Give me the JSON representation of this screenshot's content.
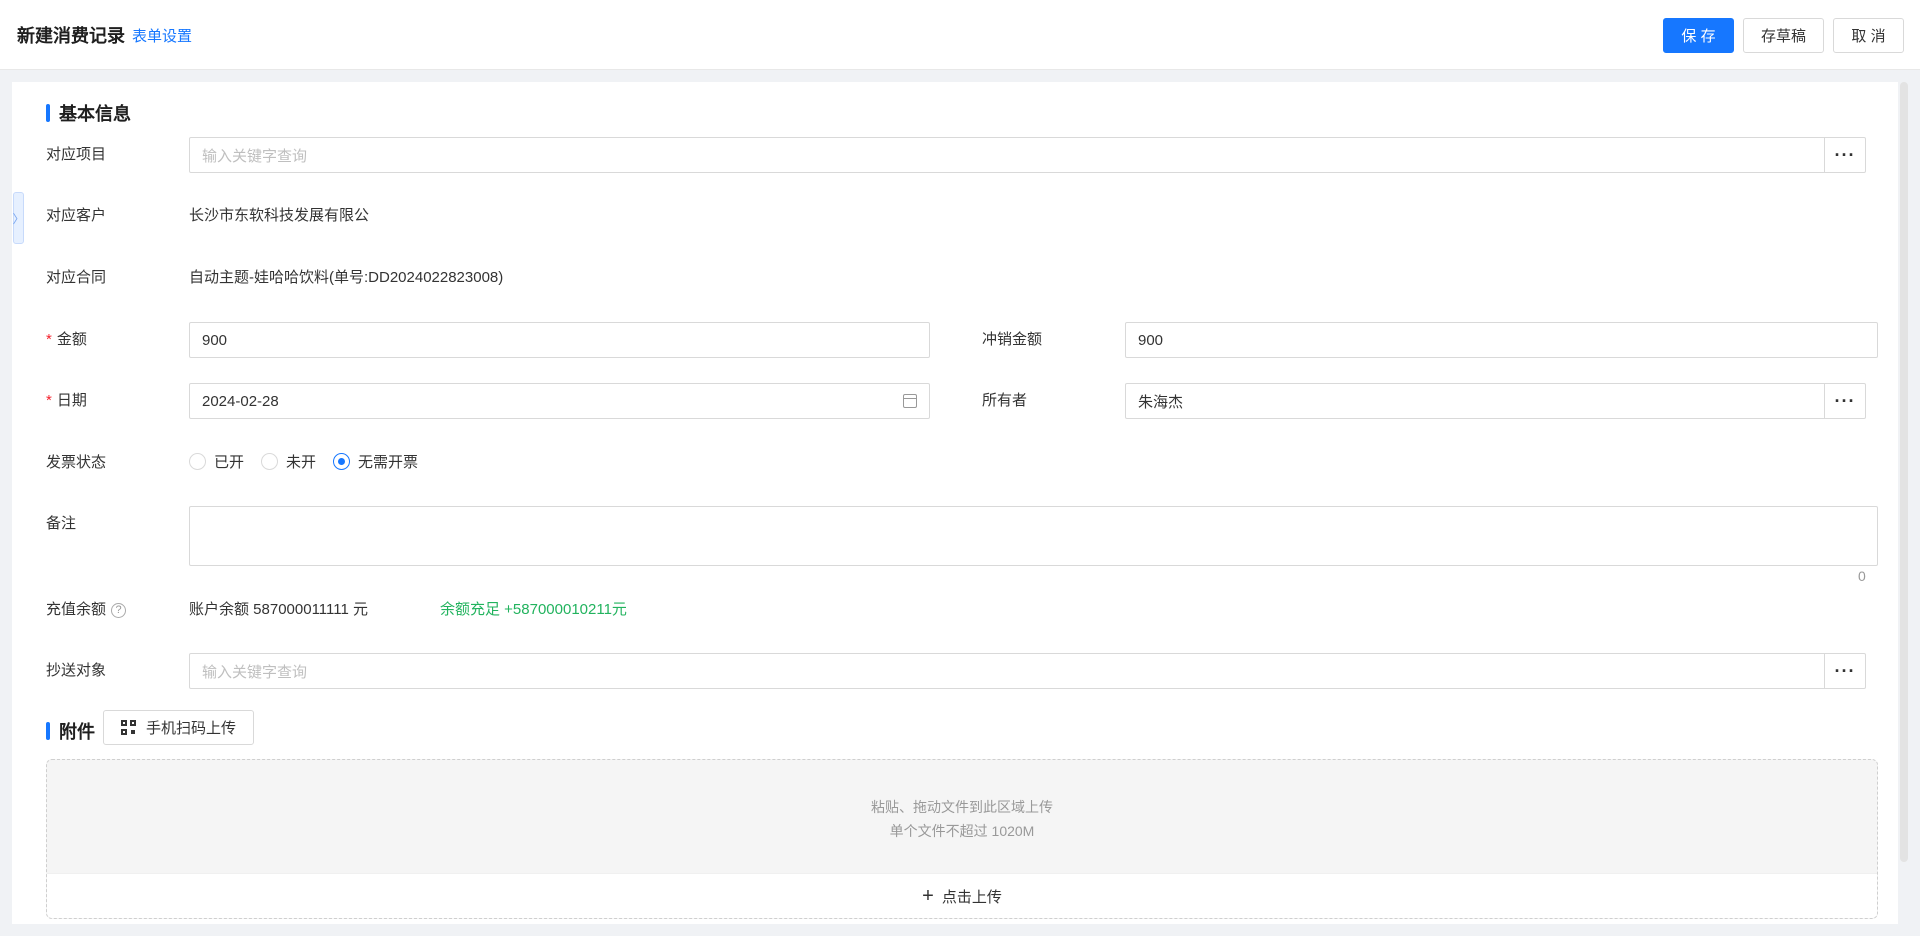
{
  "header": {
    "title": "新建消费记录",
    "form_settings": "表单设置",
    "save": "保 存",
    "draft": "存草稿",
    "cancel": "取 消"
  },
  "basic": {
    "section_title": "基本信息",
    "project_label": "对应项目",
    "project_placeholder": "输入关键字查询",
    "customer_label": "对应客户",
    "customer_value": "长沙市东软科技发展有限公",
    "contract_label": "对应合同",
    "contract_value": "自动主题-娃哈哈饮料(单号:DD2024022823008)",
    "amount_label": "金额",
    "amount_value": "900",
    "writeoff_label": "冲销金额",
    "writeoff_value": "900",
    "date_label": "日期",
    "date_value": "2024-02-28",
    "owner_label": "所有者",
    "owner_value": "朱海杰",
    "invoice_label": "发票状态",
    "invoice_options": [
      "已开",
      "未开",
      "无需开票"
    ],
    "invoice_selected": "无需开票",
    "remark_label": "备注",
    "remark_count": "0",
    "recharge_label": "充值余额",
    "recharge_balance": "账户余额 587000011111 元",
    "recharge_status": "余额充足 +587000010211元",
    "cc_label": "抄送对象",
    "cc_placeholder": "输入关键字查询"
  },
  "attachment": {
    "section_title": "附件",
    "scan_upload": "手机扫码上传",
    "hint_line1": "粘贴、拖动文件到此区域上传",
    "hint_line2": "单个文件不超过 1020M",
    "click_upload": "点击上传"
  },
  "icons": {
    "more": "ellipsis-icon",
    "calendar": "calendar-icon",
    "help": "question-circle-icon",
    "qr": "qrcode-icon",
    "plus": "plus-icon",
    "collapse": "chevron-right-icon"
  },
  "colors": {
    "primary": "#1677ff",
    "required": "#f5222d",
    "success": "#22b35e"
  }
}
